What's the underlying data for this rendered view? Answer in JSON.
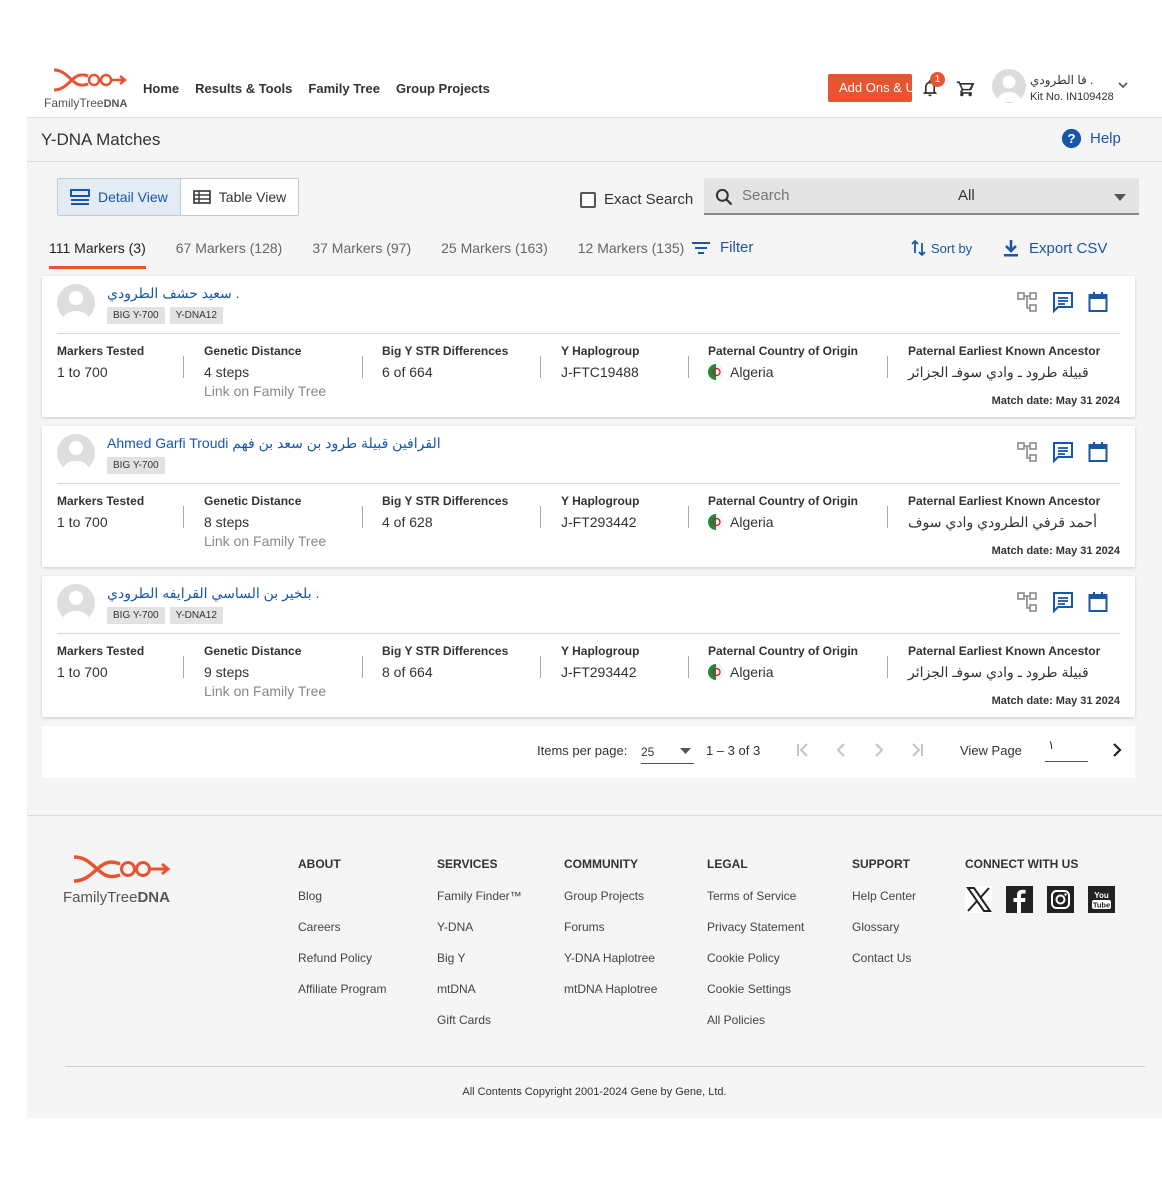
{
  "header": {
    "logo_text_1": "FamilyTree",
    "logo_text_2": "DNA",
    "nav": [
      "Home",
      "Results & Tools",
      "Family Tree",
      "Group Projects"
    ],
    "addons_label": "Add Ons & Up",
    "notification_count": "1",
    "user_name": "قا الطرودي .",
    "kit_no": "Kit No. IN109428",
    "brand_color": "#e8542f"
  },
  "titlebar": {
    "title": "Y-DNA Matches",
    "help": "Help"
  },
  "toolbar": {
    "detail_view": "Detail View",
    "table_view": "Table View",
    "exact_search": "Exact Search",
    "search_placeholder": "Search",
    "search_scope": "All"
  },
  "tabs": [
    "111 Markers (3)",
    "67 Markers (128)",
    "37 Markers (97)",
    "25 Markers (163)",
    "12 Markers (135)"
  ],
  "actions": {
    "filter": "Filter",
    "sort_by": "Sort by",
    "export": "Export CSV"
  },
  "labels": {
    "markers_tested": "Markers Tested",
    "genetic_distance": "Genetic Distance",
    "str_diff": "Big Y STR Differences",
    "haplogroup": "Y Haplogroup",
    "country": "Paternal Country of Origin",
    "ancestor": "Paternal Earliest Known Ancestor",
    "link": "Link on Family Tree"
  },
  "matches": [
    {
      "name": "سعيد حشف الطرودي .",
      "badges": [
        "BIG Y-700",
        "Y-DNA12"
      ],
      "markers_tested": "1 to 700",
      "genetic_distance": "4 steps",
      "str_diff": "6 of 664",
      "haplogroup": "J-FTC19488",
      "country": "Algeria",
      "ancestor": "قبيلة طرود ـ وادي سوفـ الجزائر",
      "match_date": "Match date: May 31 2024"
    },
    {
      "name": "Ahmed Garfi Troudi القرافين قبيلة طرود بن سعد بن فهم",
      "badges": [
        "BIG Y-700"
      ],
      "markers_tested": "1 to 700",
      "genetic_distance": "8 steps",
      "str_diff": "4 of 628",
      "haplogroup": "J-FT293442",
      "country": "Algeria",
      "ancestor": "أحمد قرفي الطرودي وادي سوف",
      "match_date": "Match date: May 31 2024"
    },
    {
      "name": "بلخير بن الساسي القرايفه الطرودي .",
      "badges": [
        "BIG Y-700",
        "Y-DNA12"
      ],
      "markers_tested": "1 to 700",
      "genetic_distance": "9 steps",
      "str_diff": "8 of 664",
      "haplogroup": "J-FT293442",
      "country": "Algeria",
      "ancestor": "قبيلة طرود ـ وادي سوفـ الجزائر",
      "match_date": "Match date: May 31 2024"
    }
  ],
  "paginator": {
    "items_per_page_label": "Items per page:",
    "items_per_page": "25",
    "range": "1 – 3 of 3",
    "view_page_label": "View Page",
    "view_page_value": "١"
  },
  "footer": {
    "logo_text_1": "FamilyTree",
    "logo_text_2": "DNA",
    "columns": [
      {
        "heading": "ABOUT",
        "items": [
          "Blog",
          "Careers",
          "Refund Policy",
          "Affiliate Program"
        ]
      },
      {
        "heading": "SERVICES",
        "items": [
          "Family Finder™",
          "Y-DNA",
          "Big Y",
          "mtDNA",
          "Gift Cards"
        ]
      },
      {
        "heading": "COMMUNITY",
        "items": [
          "Group Projects",
          "Forums",
          "Y-DNA Haplotree",
          "mtDNA Haplotree"
        ]
      },
      {
        "heading": "LEGAL",
        "items": [
          "Terms of Service",
          "Privacy Statement",
          "Cookie Policy",
          "Cookie Settings",
          "All Policies"
        ]
      },
      {
        "heading": "SUPPORT",
        "items": [
          "Help Center",
          "Glossary",
          "Contact Us"
        ]
      }
    ],
    "connect_heading": "CONNECT WITH US",
    "social_icons": [
      "x-icon",
      "facebook-icon",
      "instagram-icon",
      "youtube-icon"
    ],
    "youtube_text_1": "You",
    "youtube_text_2": "Tube",
    "copyright": "All Contents Copyright 2001-2024 Gene by Gene, Ltd."
  }
}
